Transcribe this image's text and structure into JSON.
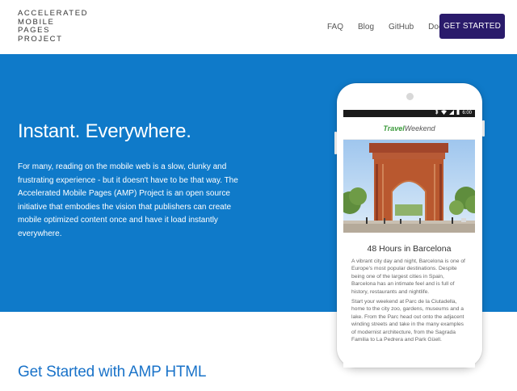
{
  "header": {
    "logo_lines": [
      "ACCELERATED",
      "MOBILE",
      "PAGES",
      "PROJECT"
    ],
    "nav": [
      "FAQ",
      "Blog",
      "GitHub",
      "Docs"
    ],
    "cta_label": "GET STARTED"
  },
  "hero": {
    "title": "Instant. Everywhere.",
    "text": "For many, reading on the mobile web is a slow, clunky and frustrating experience - but it doesn't have to be that way. The Accelerated Mobile Pages (AMP) Project is an open source initiative that embodies the vision that publishers can create mobile optimized content once and have it load instantly everywhere."
  },
  "phone": {
    "status_time": "6:00",
    "status_icons": [
      "bluetooth-icon",
      "wifi-icon",
      "signal-icon",
      "battery-icon"
    ],
    "brand_part1": "Travel",
    "brand_part2": "Weekend",
    "article_title": "48 Hours in Barcelona",
    "paragraph1": "A vibrant city day and night, Barcelona is one of Europe's most popular destinations. Despite being one of the largest cities in Spain, Barcelona has an intimate feel and is full of history, restaurants and nightlife.",
    "paragraph2": "Start your weekend at Parc de la Ciutadella, home to the city zoo, gardens, museums and a lake. From the Parc head out onto the adjacent winding streets and take in the many examples of modernist architecture, from the Sagrada Familia to La Pedrera and Park Güell."
  },
  "section": {
    "title": "Get Started with AMP HTML"
  },
  "colors": {
    "hero_bg": "#0f7ac9",
    "cta_bg": "#2a1b6b",
    "section_title": "#1a73c9",
    "brand_green": "#3b9a3b"
  }
}
